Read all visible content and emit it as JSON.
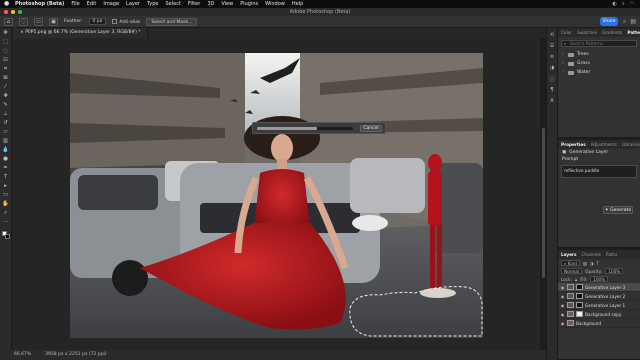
{
  "os_menubar": {
    "app_name": "Photoshop (Beta)",
    "items": [
      "File",
      "Edit",
      "Image",
      "Layer",
      "Type",
      "Select",
      "Filter",
      "3D",
      "View",
      "Plugins",
      "Window",
      "Help"
    ]
  },
  "window": {
    "title": "Adobe Photoshop (Beta)"
  },
  "options_bar": {
    "feather_label": "Feather:",
    "feather_value": "0 px",
    "anti_alias_label": "Anti-alias",
    "select_mask_label": "Select and Mask...",
    "share_label": "Share"
  },
  "document_tab": {
    "label": "P0P5.png @ 66.7% (Generative Layer 3, RGB/8#) *"
  },
  "generative_progress": {
    "cancel_label": "Cancel",
    "progress": 0.62
  },
  "status_bar": {
    "zoom": "66.67%",
    "doc_size": "3958 px x 2251 px (72 ppi)"
  },
  "patterns_panel": {
    "tabs": [
      "Color",
      "Swatches",
      "Gradients",
      "Patterns"
    ],
    "active_tab": "Patterns",
    "search_placeholder": "Search Patterns",
    "folders": [
      "Trees",
      "Grass",
      "Water"
    ]
  },
  "properties_panel": {
    "tabs": [
      "Properties",
      "Adjustments",
      "Libraries"
    ],
    "active_tab": "Properties",
    "layer_type": "Generative Layer",
    "prompt_label": "Prompt",
    "prompt_value": "reflective puddle",
    "generate_label": "Generate"
  },
  "layers_panel": {
    "tabs": [
      "Layers",
      "Channels",
      "Paths"
    ],
    "active_tab": "Layers",
    "kind_label": "Kind",
    "blend_mode": "Normal",
    "opacity_label": "Opacity:",
    "opacity_value": "100%",
    "lock_label": "Lock:",
    "fill_label": "Fill:",
    "fill_value": "100%",
    "layers": [
      {
        "name": "Generative Layer 3",
        "mask": "dark",
        "active": true
      },
      {
        "name": "Generative Layer 2",
        "mask": "dark",
        "active": false
      },
      {
        "name": "Generative Layer 1",
        "mask": "dark",
        "active": false
      },
      {
        "name": "Background copy",
        "mask": "white",
        "active": false
      },
      {
        "name": "Background",
        "mask": "none",
        "active": false
      }
    ]
  },
  "colors": {
    "share_blue": "#2b72e8",
    "dress_red": "#b3141b"
  }
}
